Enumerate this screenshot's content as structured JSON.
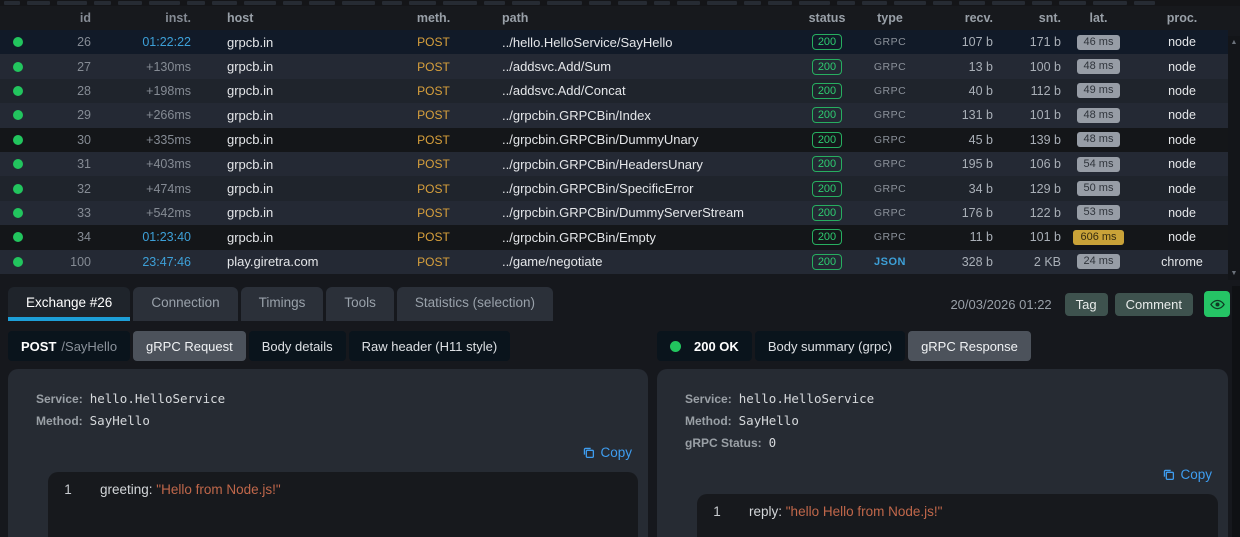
{
  "table": {
    "headers": {
      "id": "id",
      "inst": "inst.",
      "host": "host",
      "meth": "meth.",
      "path": "path",
      "status": "status",
      "type": "type",
      "recv": "recv.",
      "snt": "snt.",
      "lat": "lat.",
      "proc": "proc."
    },
    "rows": [
      {
        "id": "26",
        "inst": "01:22:22",
        "inst_style": "time",
        "host": "grpcb.in",
        "meth": "POST",
        "path": "../hello.HelloService/SayHello",
        "status": "200",
        "type": "GRPC",
        "type_style": "grpc",
        "recv": "107 b",
        "snt": "171 b",
        "lat": "46 ms",
        "lat_style": "normal",
        "proc": "node",
        "shade": "selected"
      },
      {
        "id": "27",
        "inst": "+130ms",
        "inst_style": "delta",
        "host": "grpcb.in",
        "meth": "POST",
        "path": "../addsvc.Add/Sum",
        "status": "200",
        "type": "GRPC",
        "type_style": "grpc",
        "recv": "13 b",
        "snt": "100 b",
        "lat": "48 ms",
        "lat_style": "normal",
        "proc": "node",
        "shade": "a"
      },
      {
        "id": "28",
        "inst": "+198ms",
        "inst_style": "delta",
        "host": "grpcb.in",
        "meth": "POST",
        "path": "../addsvc.Add/Concat",
        "status": "200",
        "type": "GRPC",
        "type_style": "grpc",
        "recv": "40 b",
        "snt": "112 b",
        "lat": "49 ms",
        "lat_style": "normal",
        "proc": "node",
        "shade": "b"
      },
      {
        "id": "29",
        "inst": "+266ms",
        "inst_style": "delta",
        "host": "grpcb.in",
        "meth": "POST",
        "path": "../grpcbin.GRPCBin/Index",
        "status": "200",
        "type": "GRPC",
        "type_style": "grpc",
        "recv": "131 b",
        "snt": "101 b",
        "lat": "48 ms",
        "lat_style": "normal",
        "proc": "node",
        "shade": "a"
      },
      {
        "id": "30",
        "inst": "+335ms",
        "inst_style": "delta",
        "host": "grpcb.in",
        "meth": "POST",
        "path": "../grpcbin.GRPCBin/DummyUnary",
        "status": "200",
        "type": "GRPC",
        "type_style": "grpc",
        "recv": "45 b",
        "snt": "139 b",
        "lat": "48 ms",
        "lat_style": "normal",
        "proc": "node",
        "shade": "dark"
      },
      {
        "id": "31",
        "inst": "+403ms",
        "inst_style": "delta",
        "host": "grpcb.in",
        "meth": "POST",
        "path": "../grpcbin.GRPCBin/HeadersUnary",
        "status": "200",
        "type": "GRPC",
        "type_style": "grpc",
        "recv": "195 b",
        "snt": "106 b",
        "lat": "54 ms",
        "lat_style": "normal",
        "proc": "node",
        "shade": "a"
      },
      {
        "id": "32",
        "inst": "+474ms",
        "inst_style": "delta",
        "host": "grpcb.in",
        "meth": "POST",
        "path": "../grpcbin.GRPCBin/SpecificError",
        "status": "200",
        "type": "GRPC",
        "type_style": "grpc",
        "recv": "34 b",
        "snt": "129 b",
        "lat": "50 ms",
        "lat_style": "normal",
        "proc": "node",
        "shade": "b"
      },
      {
        "id": "33",
        "inst": "+542ms",
        "inst_style": "delta",
        "host": "grpcb.in",
        "meth": "POST",
        "path": "../grpcbin.GRPCBin/DummyServerStream",
        "status": "200",
        "type": "GRPC",
        "type_style": "grpc",
        "recv": "176 b",
        "snt": "122 b",
        "lat": "53 ms",
        "lat_style": "normal",
        "proc": "node",
        "shade": "a"
      },
      {
        "id": "34",
        "inst": "01:23:40",
        "inst_style": "time",
        "host": "grpcb.in",
        "meth": "POST",
        "path": "../grpcbin.GRPCBin/Empty",
        "status": "200",
        "type": "GRPC",
        "type_style": "grpc",
        "recv": "11 b",
        "snt": "101 b",
        "lat": "606 ms",
        "lat_style": "warn",
        "proc": "node",
        "shade": "dark"
      },
      {
        "id": "100",
        "inst": "23:47:46",
        "inst_style": "time",
        "host": "play.giretra.com",
        "meth": "POST",
        "path": "../game/negotiate",
        "status": "200",
        "type": "JSON",
        "type_style": "json",
        "recv": "328 b",
        "snt": "2 KB",
        "lat": "24 ms",
        "lat_style": "normal",
        "proc": "chrome",
        "shade": "a"
      }
    ]
  },
  "tabs": {
    "items": [
      {
        "label": "Exchange #26",
        "active": true
      },
      {
        "label": "Connection",
        "active": false
      },
      {
        "label": "Timings",
        "active": false
      },
      {
        "label": "Tools",
        "active": false
      },
      {
        "label": "Statistics (selection)",
        "active": false
      }
    ]
  },
  "toolbar": {
    "timestamp": "20/03/2026 01:22",
    "tag_label": "Tag",
    "comment_label": "Comment"
  },
  "request_panel": {
    "method": "POST",
    "path_label": "/SayHello",
    "tabs": [
      {
        "label": "gRPC Request",
        "active": true
      },
      {
        "label": "Body details",
        "active": false
      },
      {
        "label": "Raw header (H11 style)",
        "active": false
      }
    ],
    "meta": [
      {
        "label": "Service:",
        "value": "hello.HelloService"
      },
      {
        "label": "Method:",
        "value": "SayHello"
      }
    ],
    "copy_label": "Copy",
    "code": {
      "line_no": "1",
      "key": "greeting: ",
      "string": "\"Hello from Node.js!\""
    }
  },
  "response_panel": {
    "status_label": "200 OK",
    "tabs": [
      {
        "label": "Body summary (grpc)",
        "active": false
      },
      {
        "label": "gRPC Response",
        "active": true
      }
    ],
    "meta": [
      {
        "label": "Service:",
        "value": "hello.HelloService"
      },
      {
        "label": "Method:",
        "value": "SayHello"
      },
      {
        "label": "gRPC Status:",
        "value": "0"
      }
    ],
    "copy_label": "Copy",
    "code": {
      "line_no": "1",
      "key": "reply: ",
      "string": "\"hello Hello from Node.js!\""
    }
  },
  "colors": {
    "accent_blue": "#1d9fd8",
    "link_blue": "#3e9df0",
    "time_blue": "#3da0d8",
    "green": "#2ecc71",
    "method_amber": "#d8a03c",
    "string_orange": "#c0674a",
    "warn_badge": "#c9a238",
    "eye_green": "#25c465"
  }
}
